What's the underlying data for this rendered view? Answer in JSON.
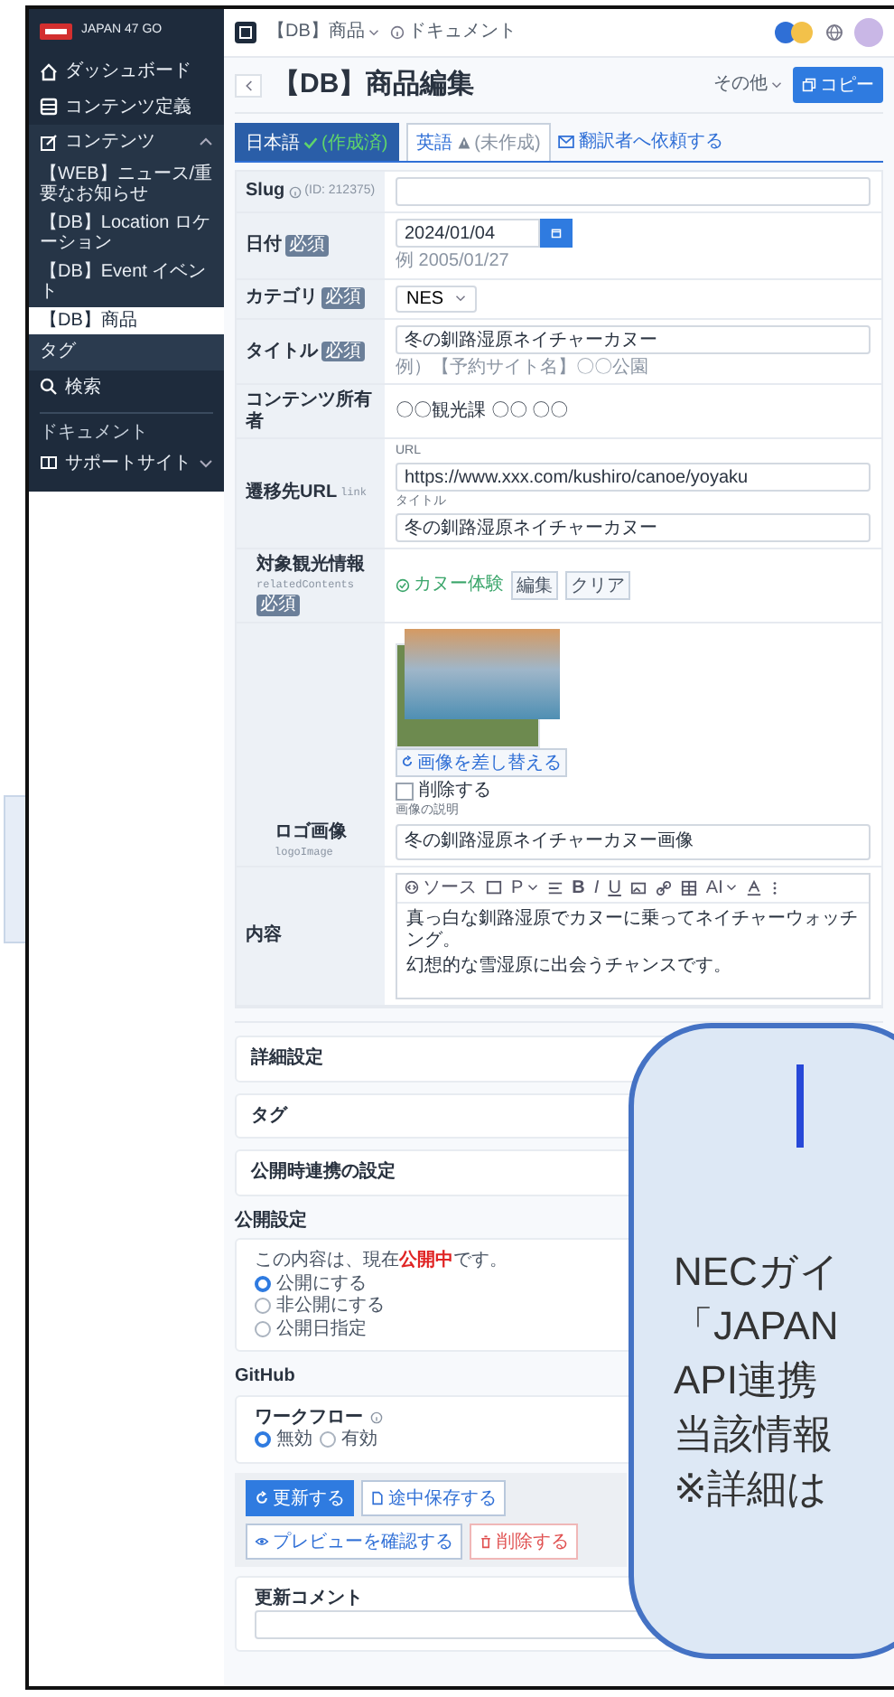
{
  "sidebar": {
    "brand": "JAPAN 47 GO",
    "dashboard": "ダッシュボード",
    "definitions": "コンテンツ定義",
    "contents": {
      "label": "コンテンツ",
      "expanded": true,
      "children": [
        {
          "label": "【WEB】ニュース/重要なお知らせ",
          "selected": false
        },
        {
          "label": "【DB】Location ロケーション",
          "selected": false
        },
        {
          "label": "【DB】Event イベント",
          "selected": false
        },
        {
          "label": "【DB】商品",
          "selected": true
        }
      ]
    },
    "tags": "タグ",
    "search": "検索",
    "section": "ドキュメント",
    "support": {
      "label": "サポートサイト",
      "expanded": false
    }
  },
  "topbar": {
    "breadcrumb": "【DB】商品",
    "docs": "ドキュメント"
  },
  "header": {
    "title": "【DB】商品編集",
    "more": "その他",
    "copy": "コピー"
  },
  "tabs": [
    {
      "label": "日本語",
      "status": "(作成済)",
      "kind": "done",
      "selected": true
    },
    {
      "label": "英語",
      "status": "(未作成)",
      "kind": "missing",
      "selected": false
    }
  ],
  "request_link": "翻訳者へ依頼する",
  "slug": {
    "label": "Slug",
    "id": "(ID: 212375)"
  },
  "date": {
    "label": "日付",
    "badge": "必須",
    "value": "2024/01/04",
    "hint": "例 2005/01/27"
  },
  "category": {
    "label": "カテゴリ",
    "badge": "必須",
    "value": "NES"
  },
  "title_field": {
    "label": "タイトル",
    "badge": "必須",
    "value": "冬の釧路湿原ネイチャーカヌー",
    "hint": "例）【予約サイト名】〇〇公園"
  },
  "owner": {
    "label": "コンテンツ所有者",
    "value": "〇〇観光課 〇〇 〇〇"
  },
  "link": {
    "label": "遷移先URL",
    "key": "link",
    "url_label": "URL",
    "url": "https://www.xxx.com/kushiro/canoe/yoyaku",
    "title_label": "タイトル",
    "title": "冬の釧路湿原ネイチャーカヌー"
  },
  "related": {
    "label": "対象観光情報",
    "key": "relatedContents",
    "badge": "必須",
    "item": "カヌー体験",
    "edit": "編集",
    "clear": "クリア"
  },
  "logo": {
    "label": "ロゴ画像",
    "key": "logoImage",
    "replace": "画像を差し替える",
    "delete": {
      "label": "削除する",
      "checked": false
    },
    "caption_label": "画像の説明",
    "caption": "冬の釧路湿原ネイチャーカヌー画像"
  },
  "body": {
    "label": "内容",
    "source": "ソース",
    "paragraph": "P",
    "bold": "B",
    "italic": "I",
    "underline": "U",
    "ai": "AI",
    "paragraphs": [
      "真っ白な釧路湿原でカヌーに乗ってネイチャーウォッチング。",
      "幻想的な雪湿原に出会うチャンスです。"
    ]
  },
  "panels": [
    "詳細設定",
    "タグ",
    "公開時連携の設定"
  ],
  "publish": {
    "heading": "公開設定",
    "status": "この内容は、現在**公開中**です。",
    "options": [
      {
        "label": "公開にする",
        "selected": true
      },
      {
        "label": "非公開にする",
        "selected": false
      },
      {
        "label": "公開日指定",
        "selected": false
      }
    ]
  },
  "github": {
    "heading": "GitHub",
    "label": "ワークフロー",
    "options": [
      {
        "label": "無効",
        "selected": true
      },
      {
        "label": "有効",
        "selected": false
      }
    ]
  },
  "actions": [
    {
      "label": "更新する",
      "kind": "primary"
    },
    {
      "label": "途中保存する",
      "kind": "save"
    },
    {
      "label": "プレビューを確認する",
      "kind": "preview"
    },
    {
      "label": "削除する",
      "kind": "danger"
    }
  ],
  "comment": {
    "label": "更新コメント"
  },
  "callout": {
    "lines": [
      "NECガイ",
      "「JAPAN",
      "API連携",
      "当該情報",
      "※詳細は"
    ]
  }
}
